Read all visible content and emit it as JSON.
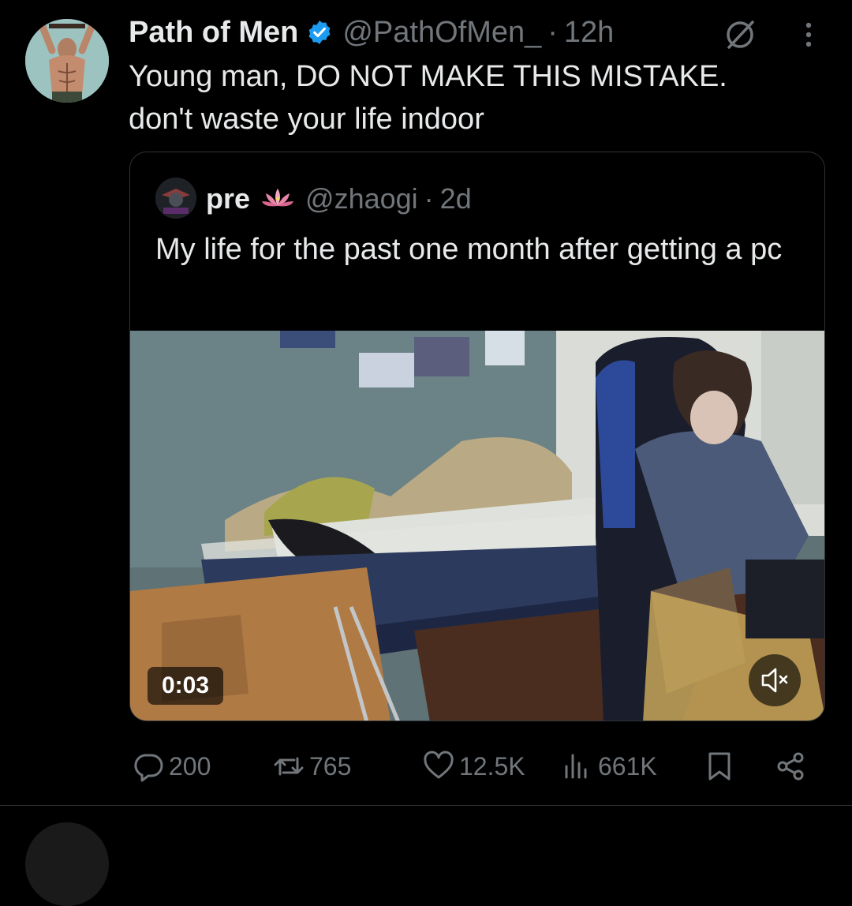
{
  "tweet": {
    "author_name": "Path of Men",
    "author_handle": "@PathOfMen_",
    "separator": "·",
    "time": "12h",
    "text_line1": "Young man, DO NOT MAKE THIS MISTAKE.",
    "text_line2": "don't waste your life indoor"
  },
  "quote": {
    "author_name": "pre",
    "author_handle": "@zhaogi",
    "separator": "·",
    "time": "2d",
    "text": "My life for the past one month after getting a pc",
    "video_timer": "0:03"
  },
  "actions": {
    "replies": "200",
    "reposts": "765",
    "likes": "12.5K",
    "views": "661K"
  },
  "icons": {
    "verified": "verified-badge-icon",
    "grok": "grok-icon",
    "more": "more-dots-icon",
    "reply": "reply-icon",
    "repost": "repost-icon",
    "like": "heart-icon",
    "views": "views-bars-icon",
    "bookmark": "bookmark-icon",
    "share": "share-icon",
    "mute": "muted-speaker-icon",
    "lotus": "lotus-icon"
  },
  "colors": {
    "background": "#000000",
    "text": "#e7e9ea",
    "secondary": "#71767b",
    "verified": "#1d9bf0",
    "border": "#2f3336"
  }
}
